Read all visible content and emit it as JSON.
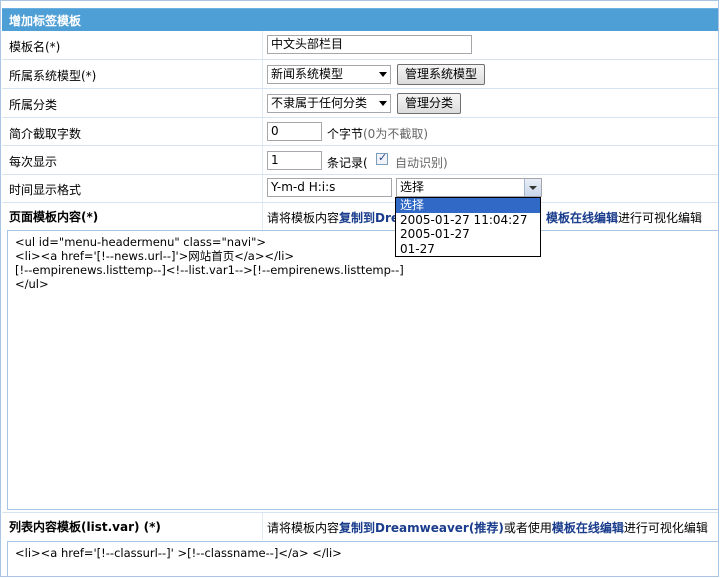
{
  "header": {
    "title": "增加标签模板"
  },
  "rows": {
    "name": {
      "label": "模板名(*)",
      "value": "中文头部栏目"
    },
    "model": {
      "label": "所属系统模型(*)",
      "selected": "新闻系统模型",
      "button": "管理系统模型"
    },
    "category": {
      "label": "所属分类",
      "selected": "不隶属于任何分类",
      "button": "管理分类"
    },
    "intro": {
      "label": "简介截取字数",
      "value": "0",
      "suffix": "个字节",
      "note": "(0为不截取)"
    },
    "per_page": {
      "label": "每次显示",
      "value": "1",
      "suffix": "条记录(",
      "checkbox_label": "自动识别)"
    },
    "time_format": {
      "label": "时间显示格式",
      "value": "Y-m-d H:i:s",
      "selected": "选择"
    }
  },
  "dropdown": {
    "options": [
      "选择",
      "2005-01-27 11:04:27",
      "2005-01-27",
      "01-27"
    ]
  },
  "page_template": {
    "label": "页面模板内容(*)",
    "hint_prefix": "请将模板内容",
    "hint_link1": "复制到Dre",
    "hint_tail_link": "模板在线编辑",
    "hint_suffix": "进行可视化编辑",
    "code": "<ul id=\"menu-headermenu\" class=\"navi\">\n<li><a href='[!--news.url--]'>网站首页</a></li>\n[!--empirenews.listtemp--]<!--list.var1-->[!--empirenews.listtemp--]\n</ul>"
  },
  "list_template": {
    "label": "列表内容模板(list.var) (*)",
    "hint_prefix": "请将模板内容",
    "hint_link1": "复制到Dreamweaver(推荐)",
    "hint_mid": "或者使用",
    "hint_link2": "模板在线编辑",
    "hint_suffix": "进行可视化编辑",
    "code": "<li><a href='[!--classurl--]' >[!--classname--]</a> </li>"
  }
}
